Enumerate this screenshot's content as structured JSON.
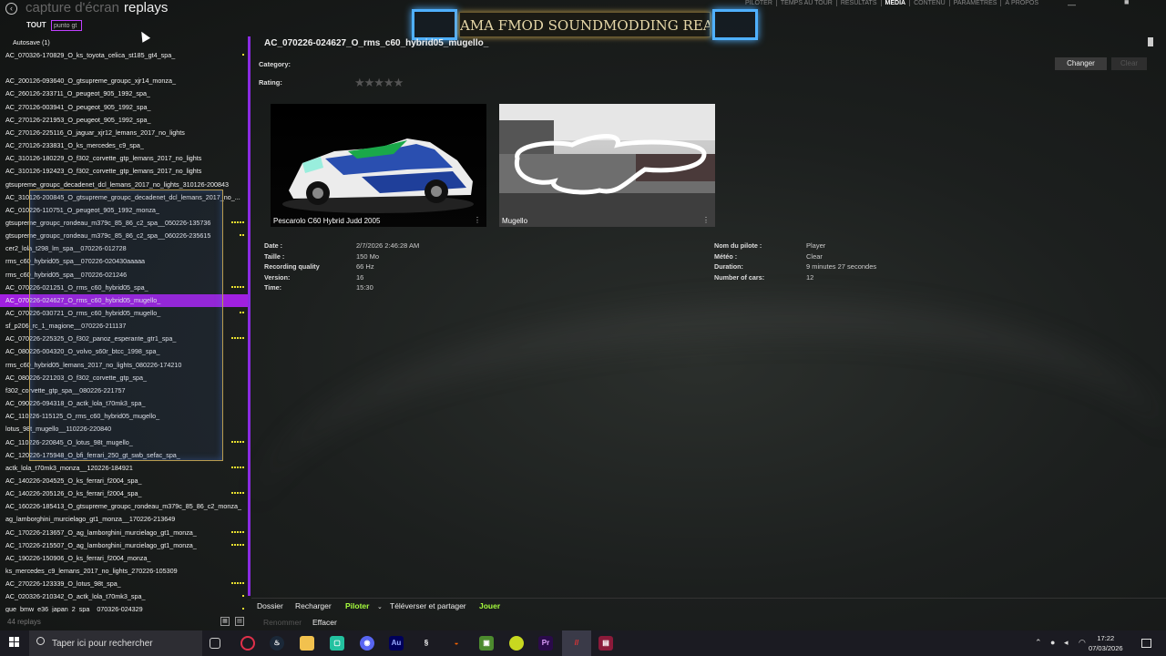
{
  "window": {
    "back_icon": "arrow-left-icon",
    "title_previous": "capture d'écran",
    "title_current": "replays",
    "nav": [
      "PILOTER",
      "TEMPS AU TOUR",
      "RÉSULTATS",
      "MÉDIA",
      "CONTENU",
      "PARAMÈTRES",
      "À PROPOS"
    ],
    "nav_active": "MÉDIA"
  },
  "banner": {
    "text": "AMA FMOD SOUNDMODDING REALISTIC STUFF",
    "border_color": "#4fb0ff"
  },
  "filter": {
    "tab_label": "TOUT",
    "search_value": "punto gt"
  },
  "list": {
    "group_label": "Autosave (1)",
    "items": [
      {
        "name": "AC_070326-170829_O_ks_toyota_celica_st185_gt4_spa_",
        "dots": 1,
        "selected": false
      },
      {
        "name": "",
        "dots": 0,
        "selected": false
      },
      {
        "name": "AC_200126-093640_O_gtsupreme_groupc_xjr14_monza_",
        "dots": 0,
        "selected": false
      },
      {
        "name": "AC_260126-233711_O_peugeot_905_1992_spa_",
        "dots": 0,
        "selected": false
      },
      {
        "name": "AC_270126-003941_O_peugeot_905_1992_spa_",
        "dots": 0,
        "selected": false
      },
      {
        "name": "AC_270126-221953_O_peugeot_905_1992_spa_",
        "dots": 0,
        "selected": false
      },
      {
        "name": "AC_270126-225116_O_jaguar_xjr12_lemans_2017_no_lights",
        "dots": 0,
        "selected": false
      },
      {
        "name": "AC_270126-233831_O_ks_mercedes_c9_spa_",
        "dots": 0,
        "selected": false
      },
      {
        "name": "AC_310126-180229_O_f302_corvette_gtp_lemans_2017_no_lights",
        "dots": 0,
        "selected": false
      },
      {
        "name": "AC_310126-192423_O_f302_corvette_gtp_lemans_2017_no_lights",
        "dots": 0,
        "selected": false
      },
      {
        "name": "gtsupreme_groupc_decadenet_dcl_lemans_2017_no_lights_310126-200843",
        "dots": 0,
        "selected": false
      },
      {
        "name": "AC_310126-200845_O_gtsupreme_groupc_decadenet_dcl_lemans_2017_no_...",
        "dots": 0,
        "selected": false
      },
      {
        "name": "AC_010226-110751_O_peugeot_905_1992_monza_",
        "dots": 0,
        "selected": false
      },
      {
        "name": "gtsupreme_groupc_rondeau_m379c_85_86_c2_spa__050226-135736",
        "dots": 5,
        "selected": false
      },
      {
        "name": "gtsupreme_groupc_rondeau_m379c_85_86_c2_spa__060226-235615",
        "dots": 2,
        "selected": false
      },
      {
        "name": "cer2_lola_t298_lm_spa__070226-012728",
        "dots": 0,
        "selected": false
      },
      {
        "name": "rms_c60_hybrid05_spa__070226-020430aaaaa",
        "dots": 0,
        "selected": false
      },
      {
        "name": "rms_c60_hybrid05_spa__070226-021246",
        "dots": 0,
        "selected": false
      },
      {
        "name": "AC_070226-021251_O_rms_c60_hybrid05_spa_",
        "dots": 5,
        "selected": false
      },
      {
        "name": "AC_070226-024627_O_rms_c60_hybrid05_mugello_",
        "dots": 0,
        "selected": true
      },
      {
        "name": "AC_070226-030721_O_rms_c60_hybrid05_mugello_",
        "dots": 2,
        "selected": false
      },
      {
        "name": "sf_p206_rc_1_magione__070226-211137",
        "dots": 0,
        "selected": false
      },
      {
        "name": "AC_070226-225325_O_f302_panoz_esperante_gtr1_spa_",
        "dots": 5,
        "selected": false
      },
      {
        "name": "AC_080226-004320_O_volvo_s60r_btcc_1998_spa_",
        "dots": 0,
        "selected": false
      },
      {
        "name": "rms_c60_hybrid05_lemans_2017_no_lights_080226-174210",
        "dots": 0,
        "selected": false
      },
      {
        "name": "AC_080226-221203_O_f302_corvette_gtp_spa_",
        "dots": 0,
        "selected": false
      },
      {
        "name": "f302_corvette_gtp_spa__080226-221757",
        "dots": 0,
        "selected": false
      },
      {
        "name": "AC_090226-094318_O_actk_lola_t70mk3_spa_",
        "dots": 0,
        "selected": false
      },
      {
        "name": "AC_110226-115125_O_rms_c60_hybrid05_mugello_",
        "dots": 0,
        "selected": false
      },
      {
        "name": "lotus_98t_mugello__110226-220840",
        "dots": 0,
        "selected": false
      },
      {
        "name": "AC_110226-220845_O_lotus_98t_mugello_",
        "dots": 5,
        "selected": false
      },
      {
        "name": "AC_120226-175948_O_bfi_ferrari_250_gt_swb_sefac_spa_",
        "dots": 0,
        "selected": false
      },
      {
        "name": "actk_lola_t70mk3_monza__120226-184921",
        "dots": 5,
        "selected": false
      },
      {
        "name": "AC_140226-204525_O_ks_ferrari_f2004_spa_",
        "dots": 0,
        "selected": false
      },
      {
        "name": "AC_140226-205126_O_ks_ferrari_f2004_spa_",
        "dots": 5,
        "selected": false
      },
      {
        "name": "AC_160226-185413_O_gtsupreme_groupc_rondeau_m379c_85_86_c2_monza_",
        "dots": 0,
        "selected": false
      },
      {
        "name": "ag_lamborghini_murcielago_gt1_monza__170226-213649",
        "dots": 0,
        "selected": false
      },
      {
        "name": "AC_170226-213657_O_ag_lamborghini_murcielago_gt1_monza_",
        "dots": 5,
        "selected": false
      },
      {
        "name": "AC_170226-215507_O_ag_lamborghini_murcielago_gt1_monza_",
        "dots": 5,
        "selected": false
      },
      {
        "name": "AC_190226-150906_O_ks_ferrari_f2004_monza_",
        "dots": 0,
        "selected": false
      },
      {
        "name": "ks_mercedes_c9_lemans_2017_no_lights_270226-105309",
        "dots": 0,
        "selected": false
      },
      {
        "name": "AC_270226-123339_O_lotus_98t_spa_",
        "dots": 5,
        "selected": false
      },
      {
        "name": "AC_020326-210342_O_actk_lola_t70mk3_spa_",
        "dots": 1,
        "selected": false
      },
      {
        "name": "gue_bmw_e36_japan_2_spa__070326-024329",
        "dots": 1,
        "selected": false
      }
    ],
    "count_label": "44 replays",
    "dot_color": "#e8e030",
    "selected_color": "#a020e0"
  },
  "detail": {
    "title": "AC_070226-024627_O_rms_c60_hybrid05_mugello_",
    "category_label": "Category:",
    "rating_label": "Rating:",
    "rating_stars": "★★★★★",
    "change_button": "Changer",
    "clear_button": "Clear",
    "car_caption": "Pescarolo C60 Hybrid Judd 2005",
    "track_caption": "Mugello",
    "more_icon": "⋮",
    "info_left": [
      {
        "label": "Date :",
        "value": "2/7/2026 2:46:28 AM"
      },
      {
        "label": "Taille :",
        "value": "150 Mo"
      },
      {
        "label": "Recording quality",
        "value": "66 Hz"
      },
      {
        "label": "Version:",
        "value": "16"
      },
      {
        "label": "Time:",
        "value": "15:30"
      }
    ],
    "info_right": [
      {
        "label": "Nom du pilote :",
        "value": "Player"
      },
      {
        "label": "Météo :",
        "value": "Clear"
      },
      {
        "label": "Duration:",
        "value": "9 minutes 27 secondes"
      },
      {
        "label": "Number of cars:",
        "value": "12"
      }
    ]
  },
  "actions": {
    "folder": "Dossier",
    "reload": "Recharger",
    "drive": "Piloter",
    "upload_share": "Téléverser et partager",
    "play": "Jouer",
    "rename": "Renommer",
    "delete": "Effacer",
    "accent": "#a8ff3e"
  },
  "taskbar": {
    "search_placeholder": "Taper ici pour rechercher",
    "apps": [
      "task-view",
      "opera",
      "steam",
      "explorer",
      "app-green",
      "discord",
      "audition",
      "app-spiral",
      "app-orange",
      "minecraft",
      "app-ball",
      "premiere",
      "assetto-corsa",
      "winrar"
    ],
    "time": "17:22",
    "date": "07/03/2026"
  }
}
